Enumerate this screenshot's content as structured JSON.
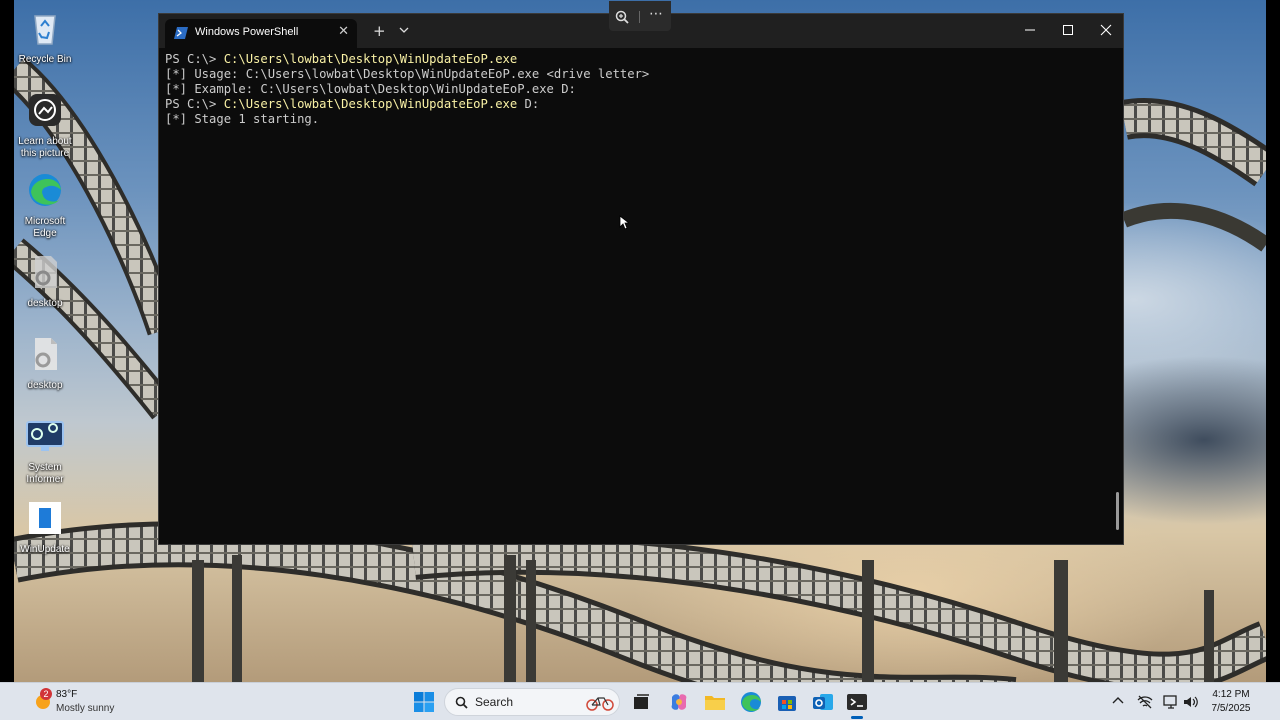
{
  "desktop": {
    "icons": [
      {
        "label": "Recycle Bin"
      },
      {
        "label": "Learn about this picture"
      },
      {
        "label": "Microsoft Edge"
      },
      {
        "label": "desktop"
      },
      {
        "label": "desktop"
      },
      {
        "label": "System Informer"
      },
      {
        "label": "WinUpdate"
      }
    ]
  },
  "terminal": {
    "tab_title": "Windows PowerShell",
    "tab_close_glyph": "✕",
    "new_tab_glyph": "+",
    "more_glyph": "⋯",
    "lines": [
      {
        "prompt": "PS C:\\> ",
        "command": "C:\\Users\\lowbat\\Desktop\\WinUpdateEoP.exe",
        "args": ""
      },
      {
        "output": "[*] Usage: C:\\Users\\lowbat\\Desktop\\WinUpdateEoP.exe <drive letter>"
      },
      {
        "output": "[*] Example: C:\\Users\\lowbat\\Desktop\\WinUpdateEoP.exe D:"
      },
      {
        "prompt": "PS C:\\> ",
        "command": "C:\\Users\\lowbat\\Desktop\\WinUpdateEoP.exe",
        "args": " D:"
      },
      {
        "output": "[*] Stage 1 starting."
      }
    ]
  },
  "taskbar": {
    "weather": {
      "badge": "2",
      "temp": "83°F",
      "condition": "Mostly sunny"
    },
    "search_label": "Search",
    "apps": [
      "start",
      "task-view",
      "copilot",
      "file-explorer",
      "edge",
      "store",
      "outlook",
      "terminal"
    ],
    "clock": {
      "time": "4:12 PM",
      "date": "7/5/2025"
    }
  },
  "colors": {
    "terminal_bg": "#0c0c0c",
    "titlebar_bg": "#202020",
    "command_text": "#f9f1a5",
    "output_text": "#cccccc",
    "taskbar_bg": "#dfe4ec",
    "accent": "#005fb8"
  }
}
